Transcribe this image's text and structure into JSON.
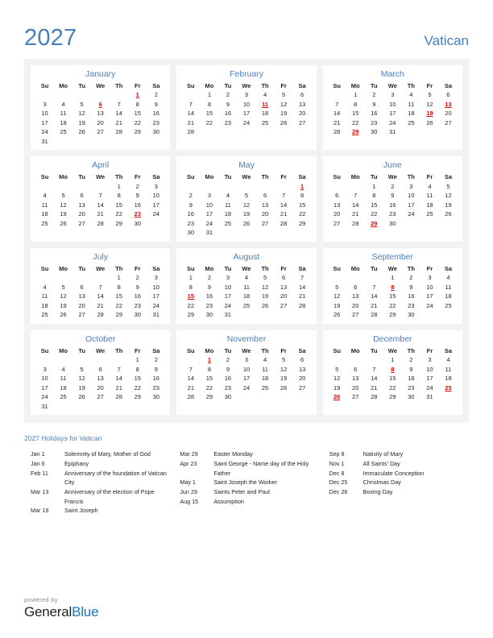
{
  "header": {
    "year": "2027",
    "country": "Vatican"
  },
  "colors": {
    "accent_blue": "#4a7ebb",
    "holiday_red": "#e00000",
    "panel_gray": "#f2f2f2",
    "brand_blue": "#1874c4"
  },
  "weekday_headers": [
    "Su",
    "Mo",
    "Tu",
    "We",
    "Th",
    "Fr",
    "Sa"
  ],
  "months": [
    {
      "name": "January",
      "lead_blanks": 5,
      "days": 31,
      "holidays": [
        1,
        6
      ]
    },
    {
      "name": "February",
      "lead_blanks": 1,
      "days": 28,
      "holidays": [
        11
      ]
    },
    {
      "name": "March",
      "lead_blanks": 1,
      "days": 31,
      "holidays": [
        13,
        19,
        29
      ]
    },
    {
      "name": "April",
      "lead_blanks": 4,
      "days": 30,
      "holidays": [
        23
      ]
    },
    {
      "name": "May",
      "lead_blanks": 6,
      "days": 31,
      "holidays": [
        1
      ]
    },
    {
      "name": "June",
      "lead_blanks": 2,
      "days": 30,
      "holidays": [
        29
      ]
    },
    {
      "name": "July",
      "lead_blanks": 4,
      "days": 31,
      "holidays": []
    },
    {
      "name": "August",
      "lead_blanks": 0,
      "days": 31,
      "holidays": [
        15
      ]
    },
    {
      "name": "September",
      "lead_blanks": 3,
      "days": 30,
      "holidays": [
        8
      ]
    },
    {
      "name": "October",
      "lead_blanks": 5,
      "days": 31,
      "holidays": []
    },
    {
      "name": "November",
      "lead_blanks": 1,
      "days": 30,
      "holidays": [
        1
      ]
    },
    {
      "name": "December",
      "lead_blanks": 3,
      "days": 31,
      "holidays": [
        8,
        25,
        26
      ]
    }
  ],
  "holidays_section": {
    "title": "2027 Holidays for Vatican",
    "columns": [
      [
        {
          "date": "Jan 1",
          "name": "Solemnity of Mary, Mother of God"
        },
        {
          "date": "Jan 6",
          "name": "Epiphany"
        },
        {
          "date": "Feb 11",
          "name": "Anniversary of the foundation of Vatican City"
        },
        {
          "date": "Mar 13",
          "name": "Anniversary of the election of Pope Francis"
        },
        {
          "date": "Mar 19",
          "name": "Saint Joseph"
        }
      ],
      [
        {
          "date": "Mar 29",
          "name": "Easter Monday"
        },
        {
          "date": "Apr 23",
          "name": "Saint George - Name day of the Holy Father"
        },
        {
          "date": "May 1",
          "name": "Saint Joseph the Worker"
        },
        {
          "date": "Jun 29",
          "name": "Saints Peter and Paul"
        },
        {
          "date": "Aug 15",
          "name": "Assumption"
        }
      ],
      [
        {
          "date": "Sep 8",
          "name": "Nativity of Mary"
        },
        {
          "date": "Nov 1",
          "name": "All Saints’ Day"
        },
        {
          "date": "Dec 8",
          "name": "Immaculate Conception"
        },
        {
          "date": "Dec 25",
          "name": "Christmas Day"
        },
        {
          "date": "Dec 26",
          "name": "Boxing Day"
        }
      ]
    ]
  },
  "footer": {
    "powered_by": "powered by",
    "brand_first": "General",
    "brand_second": "Blue"
  }
}
